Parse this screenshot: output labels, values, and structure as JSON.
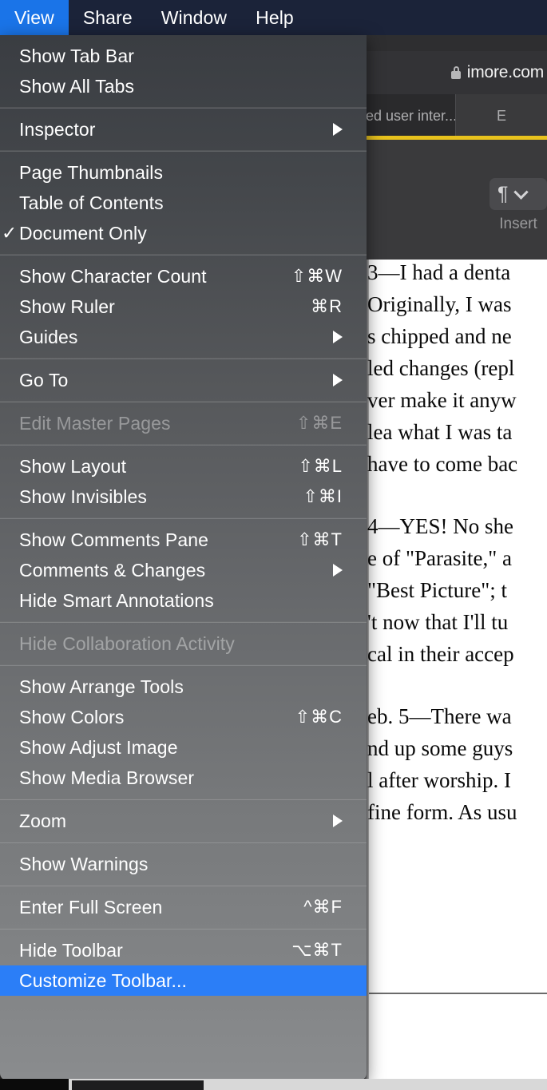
{
  "menubar": {
    "items": [
      {
        "label": "View",
        "active": true
      },
      {
        "label": "Share",
        "active": false
      },
      {
        "label": "Window",
        "active": false
      },
      {
        "label": "Help",
        "active": false
      }
    ]
  },
  "browser": {
    "url": "imore.com",
    "lock_icon": "lock-icon",
    "tabs": [
      {
        "label": "ed user inter...",
        "active": true
      },
      {
        "label": "E",
        "active": false
      }
    ]
  },
  "doc_toolbar": {
    "insert_icon": "pilcrow-icon",
    "chevron_icon": "chevron-down-icon",
    "insert_label": "Insert"
  },
  "document": {
    "paragraphs": [
      "3—I had a denta\nOriginally, I was\ns chipped and ne\nled changes (repl\nver make it anyw\nlea what I was ta\nhave to come bac",
      "4—YES! No she\ne of \"Parasite,\" a\n \"Best Picture\"; t\n't now that I'll tu\ncal in their accep",
      "eb. 5—There wa\nnd up some guys\nl after worship. I\nfine form. As usu"
    ]
  },
  "menu": {
    "title": "View",
    "groups": [
      {
        "items": [
          {
            "label": "Show Tab Bar",
            "shortcut": "",
            "submenu": false,
            "checked": false,
            "disabled": false,
            "selected": false
          },
          {
            "label": "Show All Tabs",
            "shortcut": "",
            "submenu": false,
            "checked": false,
            "disabled": false,
            "selected": false
          }
        ]
      },
      {
        "items": [
          {
            "label": "Inspector",
            "shortcut": "",
            "submenu": true,
            "checked": false,
            "disabled": false,
            "selected": false
          }
        ]
      },
      {
        "items": [
          {
            "label": "Page Thumbnails",
            "shortcut": "",
            "submenu": false,
            "checked": false,
            "disabled": false,
            "selected": false
          },
          {
            "label": "Table of Contents",
            "shortcut": "",
            "submenu": false,
            "checked": false,
            "disabled": false,
            "selected": false
          },
          {
            "label": "Document Only",
            "shortcut": "",
            "submenu": false,
            "checked": true,
            "disabled": false,
            "selected": false
          }
        ]
      },
      {
        "items": [
          {
            "label": "Show Character Count",
            "shortcut": "⇧⌘W",
            "submenu": false,
            "checked": false,
            "disabled": false,
            "selected": false
          },
          {
            "label": "Show Ruler",
            "shortcut": "⌘R",
            "submenu": false,
            "checked": false,
            "disabled": false,
            "selected": false
          },
          {
            "label": "Guides",
            "shortcut": "",
            "submenu": true,
            "checked": false,
            "disabled": false,
            "selected": false
          }
        ]
      },
      {
        "items": [
          {
            "label": "Go To",
            "shortcut": "",
            "submenu": true,
            "checked": false,
            "disabled": false,
            "selected": false
          }
        ]
      },
      {
        "items": [
          {
            "label": "Edit Master Pages",
            "shortcut": "⇧⌘E",
            "submenu": false,
            "checked": false,
            "disabled": true,
            "selected": false
          }
        ]
      },
      {
        "items": [
          {
            "label": "Show Layout",
            "shortcut": "⇧⌘L",
            "submenu": false,
            "checked": false,
            "disabled": false,
            "selected": false
          },
          {
            "label": "Show Invisibles",
            "shortcut": "⇧⌘I",
            "submenu": false,
            "checked": false,
            "disabled": false,
            "selected": false
          }
        ]
      },
      {
        "items": [
          {
            "label": "Show Comments Pane",
            "shortcut": "⇧⌘T",
            "submenu": false,
            "checked": false,
            "disabled": false,
            "selected": false
          },
          {
            "label": "Comments & Changes",
            "shortcut": "",
            "submenu": true,
            "checked": false,
            "disabled": false,
            "selected": false
          },
          {
            "label": "Hide Smart Annotations",
            "shortcut": "",
            "submenu": false,
            "checked": false,
            "disabled": false,
            "selected": false
          }
        ]
      },
      {
        "items": [
          {
            "label": "Hide Collaboration Activity",
            "shortcut": "",
            "submenu": false,
            "checked": false,
            "disabled": true,
            "selected": false
          }
        ]
      },
      {
        "items": [
          {
            "label": "Show Arrange Tools",
            "shortcut": "",
            "submenu": false,
            "checked": false,
            "disabled": false,
            "selected": false
          },
          {
            "label": "Show Colors",
            "shortcut": "⇧⌘C",
            "submenu": false,
            "checked": false,
            "disabled": false,
            "selected": false
          },
          {
            "label": "Show Adjust Image",
            "shortcut": "",
            "submenu": false,
            "checked": false,
            "disabled": false,
            "selected": false
          },
          {
            "label": "Show Media Browser",
            "shortcut": "",
            "submenu": false,
            "checked": false,
            "disabled": false,
            "selected": false
          }
        ]
      },
      {
        "items": [
          {
            "label": "Zoom",
            "shortcut": "",
            "submenu": true,
            "checked": false,
            "disabled": false,
            "selected": false
          }
        ]
      },
      {
        "items": [
          {
            "label": "Show Warnings",
            "shortcut": "",
            "submenu": false,
            "checked": false,
            "disabled": false,
            "selected": false
          }
        ]
      },
      {
        "items": [
          {
            "label": "Enter Full Screen",
            "shortcut": "^⌘F",
            "submenu": false,
            "checked": false,
            "disabled": false,
            "selected": false
          }
        ]
      },
      {
        "items": [
          {
            "label": "Hide Toolbar",
            "shortcut": "⌥⌘T",
            "submenu": false,
            "checked": false,
            "disabled": false,
            "selected": false
          },
          {
            "label": "Customize Toolbar...",
            "shortcut": "",
            "submenu": false,
            "checked": false,
            "disabled": false,
            "selected": true
          }
        ]
      }
    ]
  },
  "colors": {
    "menubar_bg": "#1b2339",
    "menubar_highlight": "#1a74e8",
    "menu_selected": "#2b7ef7",
    "tab_underline": "#e8c21d"
  }
}
